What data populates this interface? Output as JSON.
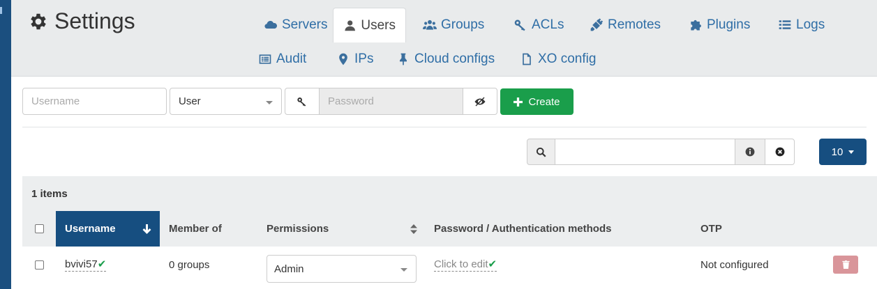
{
  "title": "Settings",
  "tabs": [
    {
      "label": "Servers",
      "icon": "cloud-icon"
    },
    {
      "label": "Users",
      "icon": "user-icon",
      "active": true
    },
    {
      "label": "Groups",
      "icon": "users-icon"
    },
    {
      "label": "ACLs",
      "icon": "key-icon"
    },
    {
      "label": "Remotes",
      "icon": "plug-icon"
    },
    {
      "label": "Plugins",
      "icon": "puzzle-icon"
    },
    {
      "label": "Logs",
      "icon": "list-icon"
    },
    {
      "label": "Audit",
      "icon": "audit-icon"
    },
    {
      "label": "IPs",
      "icon": "map-marker-icon"
    },
    {
      "label": "Cloud configs",
      "icon": "thumbtack-icon"
    },
    {
      "label": "XO config",
      "icon": "file-icon"
    }
  ],
  "create_form": {
    "username_placeholder": "Username",
    "role_value": "User",
    "password_placeholder": "Password",
    "create_label": "Create"
  },
  "filter": {
    "placeholder": ""
  },
  "page_size": "10",
  "table": {
    "items_count": "1 items",
    "columns": [
      "Username",
      "Member of",
      "Permissions",
      "Password / Authentication methods",
      "OTP"
    ],
    "rows": [
      {
        "username": "bvivi57",
        "member_of": "0 groups",
        "permissions": "Admin",
        "password": "Click to edit",
        "otp": "Not configured"
      }
    ]
  },
  "colors": {
    "primary": "#164e80",
    "success": "#1a9e4b",
    "danger": "#d9959a",
    "link": "#2f6ea6"
  }
}
